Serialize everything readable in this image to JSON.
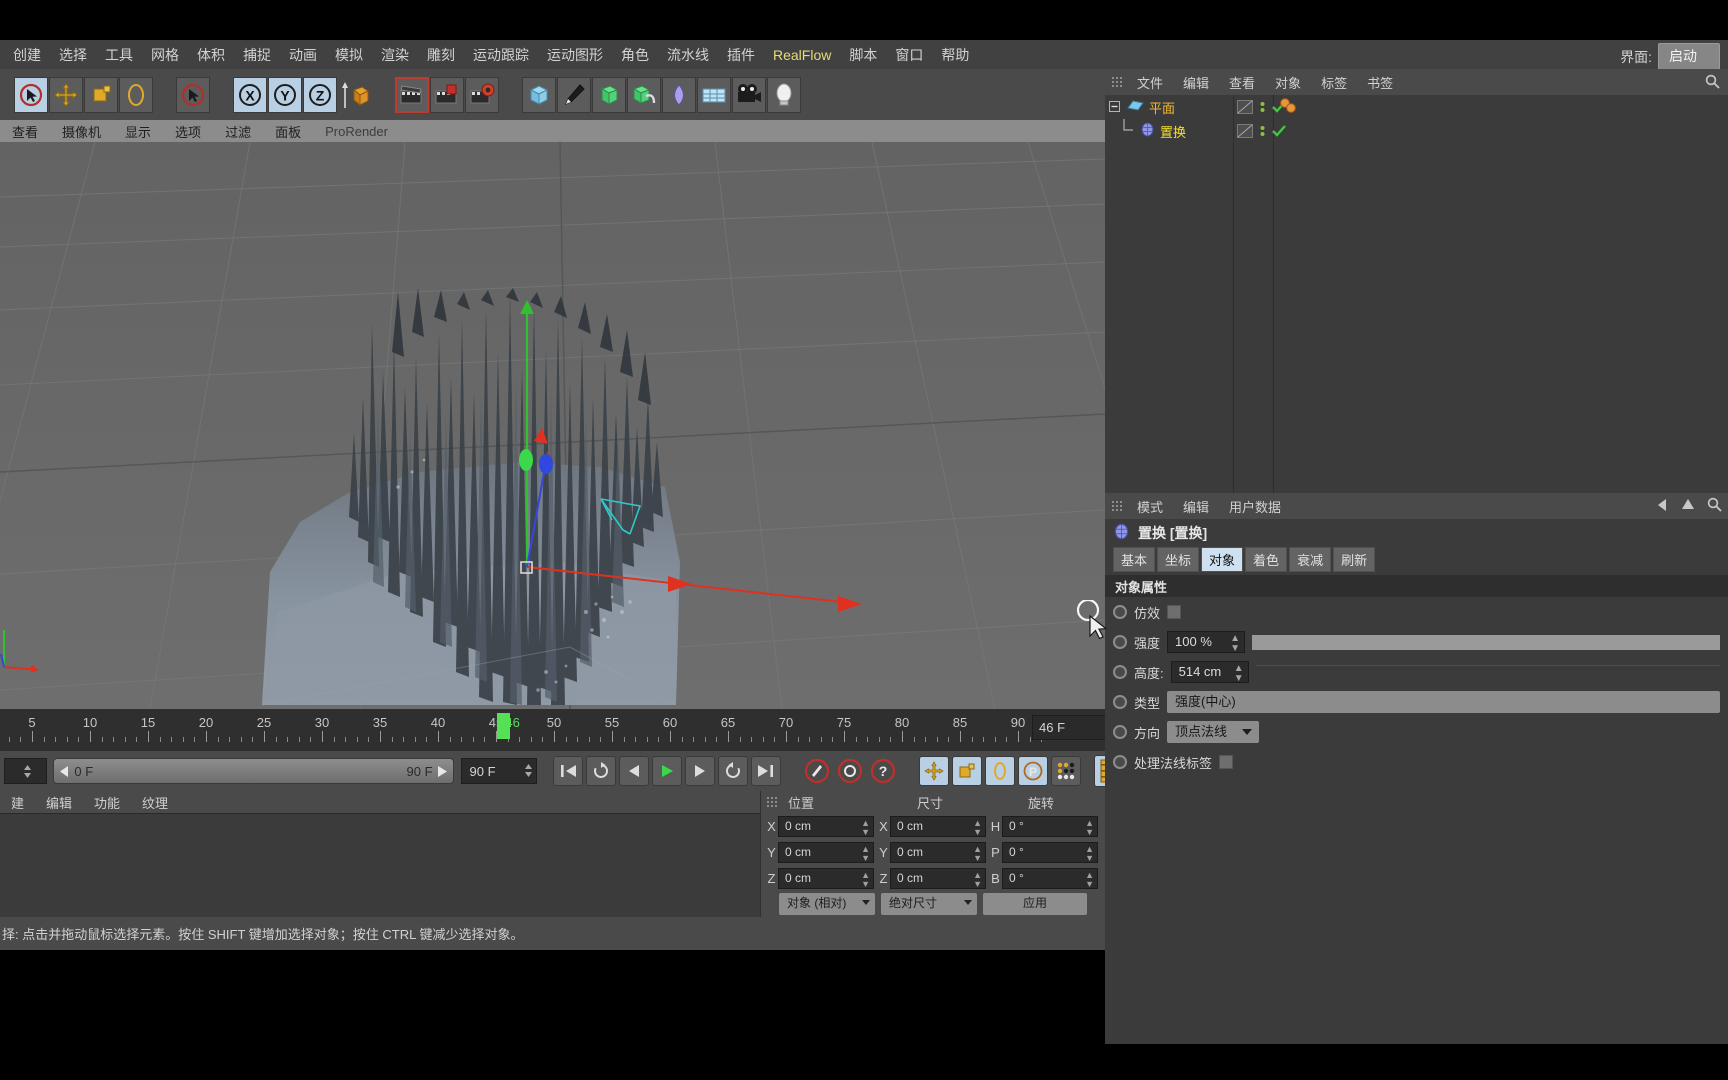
{
  "menubar": {
    "items": [
      {
        "label": "创建",
        "accent": false
      },
      {
        "label": "选择",
        "accent": false
      },
      {
        "label": "工具",
        "accent": false
      },
      {
        "label": "网格",
        "accent": false
      },
      {
        "label": "体积",
        "accent": false
      },
      {
        "label": "捕捉",
        "accent": false
      },
      {
        "label": "动画",
        "accent": false
      },
      {
        "label": "模拟",
        "accent": false
      },
      {
        "label": "渲染",
        "accent": false
      },
      {
        "label": "雕刻",
        "accent": false
      },
      {
        "label": "运动跟踪",
        "accent": false
      },
      {
        "label": "运动图形",
        "accent": false
      },
      {
        "label": "角色",
        "accent": false
      },
      {
        "label": "流水线",
        "accent": false
      },
      {
        "label": "插件",
        "accent": false
      },
      {
        "label": "RealFlow",
        "accent": true
      },
      {
        "label": "脚本",
        "accent": false
      },
      {
        "label": "窗口",
        "accent": false
      },
      {
        "label": "帮助",
        "accent": false
      }
    ],
    "interface_label": "界面:",
    "interface_value": "启动"
  },
  "toolbar": {
    "icons": [
      "live-selection-icon",
      "move-icon",
      "scale-icon",
      "rotate-icon",
      "selection-arrow-icon",
      "lock-x-icon",
      "lock-y-icon",
      "lock-z-icon",
      "world-axis-icon",
      "render-view-icon",
      "render-region-icon",
      "render-settings-icon",
      "cube-primitive-icon",
      "spline-pen-icon",
      "nurbs-icon",
      "array-icon",
      "deformer-icon",
      "scene-icon",
      "camera-icon",
      "light-icon"
    ],
    "axis_labels": [
      "X",
      "Y",
      "Z"
    ]
  },
  "viewport_menu": {
    "items": [
      "查看",
      "摄像机",
      "显示",
      "选项",
      "过滤",
      "面板",
      "ProRender"
    ],
    "corner_icons": [
      "pan-icon",
      "zoom-icon",
      "rotate-icon",
      "maximize-icon"
    ]
  },
  "viewport": {
    "axis_gizmo": {
      "x_color": "#e03020",
      "y_color": "#30d030",
      "z_color": "#3050e0"
    },
    "background_color": "#5f5f5f",
    "ground_color": "#6b6b6b",
    "object_color": "#8d98a4"
  },
  "timeline": {
    "ticks": [
      5,
      10,
      15,
      20,
      25,
      30,
      35,
      40,
      45,
      50,
      55,
      60,
      65,
      70,
      75,
      80,
      85,
      90
    ],
    "playhead_frame": 46,
    "playhead_label": "46",
    "current_frame_field": "46 F"
  },
  "transport": {
    "range_start": "0 F",
    "range_end": "90 F",
    "end_field": "90 F",
    "buttons": [
      "go-to-start-icon",
      "loop-icon",
      "step-back-icon",
      "play-icon",
      "step-forward-icon",
      "reverse-icon",
      "go-to-end-icon",
      "record-icon",
      "autokey-icon",
      "key-help-icon",
      "position-key-icon",
      "scale-key-icon",
      "rotation-key-icon",
      "param-key-icon",
      "point-level-key-icon",
      "keyframe-mode-icon"
    ]
  },
  "material_manager": {
    "menu": [
      "建",
      "编辑",
      "功能",
      "纹理"
    ]
  },
  "coords": {
    "headers": [
      "位置",
      "尺寸",
      "旋转"
    ],
    "rows": [
      {
        "axis": "X",
        "pos": "0 cm",
        "size": "0 cm",
        "rot_axis": "H",
        "rot": "0 °"
      },
      {
        "axis": "Y",
        "pos": "0 cm",
        "size": "0 cm",
        "rot_axis": "P",
        "rot": "0 °"
      },
      {
        "axis": "Z",
        "pos": "0 cm",
        "size": "0 cm",
        "rot_axis": "B",
        "rot": "0 °"
      }
    ],
    "mode_dropdown": "对象 (相对)",
    "size_dropdown": "绝对尺寸",
    "apply_button": "应用"
  },
  "status_bar": {
    "text": "择: 点击并拖动鼠标选择元素。按住 SHIFT 键增加选择对象；按住 CTRL 键减少选择对象。"
  },
  "object_manager": {
    "menu": [
      "文件",
      "编辑",
      "查看",
      "对象",
      "标签",
      "书签"
    ],
    "items": [
      {
        "name": "平面",
        "depth": 0,
        "icon": "plane-object-icon",
        "color": "#f5b82e"
      },
      {
        "name": "置换",
        "depth": 1,
        "icon": "displacer-deformer-icon",
        "color": "#f5e02e"
      }
    ],
    "tag_icons": [
      "visibility-dot-icon",
      "visibility-dot-icon"
    ],
    "material_tag_icon": "material-tag-icon"
  },
  "attribute_manager": {
    "menu": [
      "模式",
      "编辑",
      "用户数据"
    ],
    "nav_icons": [
      "back-arrow-icon",
      "up-arrow-icon",
      "search-icon"
    ],
    "object_title": "置换 [置换]",
    "object_icon": "displacer-deformer-icon",
    "tabs": [
      {
        "label": "基本",
        "active": false
      },
      {
        "label": "坐标",
        "active": false
      },
      {
        "label": "对象",
        "active": true
      },
      {
        "label": "着色",
        "active": false
      },
      {
        "label": "衰减",
        "active": false
      },
      {
        "label": "刷新",
        "active": false
      }
    ],
    "section_title": "对象属性",
    "properties": [
      {
        "label": "仿效",
        "type": "checkbox",
        "value": ""
      },
      {
        "label": "强度",
        "type": "number-slider",
        "value": "100 %"
      },
      {
        "label": "高度:",
        "type": "number-slider",
        "value": "514 cm"
      },
      {
        "label": "类型",
        "type": "dropdown-flat",
        "value": "强度(中心)"
      },
      {
        "label": "方向",
        "type": "dropdown",
        "value": "顶点法线"
      },
      {
        "label": "处理法线标签",
        "type": "checkbox",
        "value": ""
      }
    ]
  },
  "colors": {
    "accent_yellow": "#e8dc78",
    "selected_tab": "#cfe0f0",
    "playhead_green": "#55e055",
    "panel_bg": "#3b3b3b",
    "chrome_bg": "#4a4a4a"
  }
}
